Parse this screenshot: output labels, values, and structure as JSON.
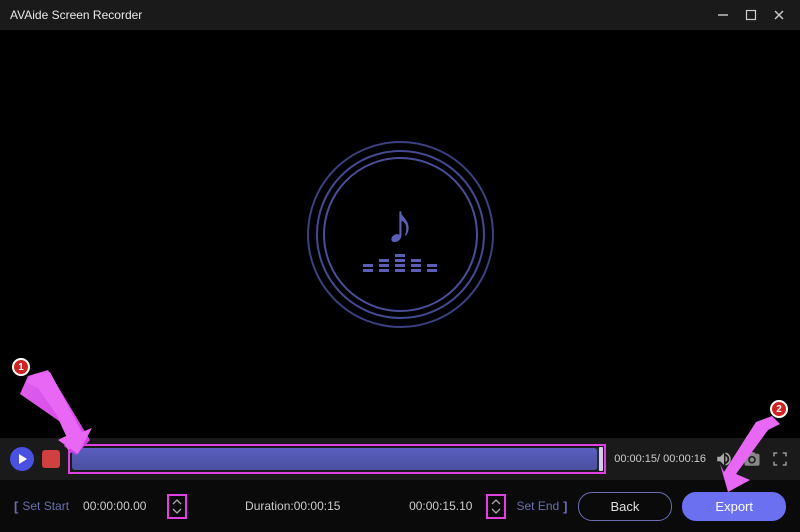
{
  "app": {
    "title": "AVAide Screen Recorder"
  },
  "player": {
    "time_current": "00:00:15",
    "time_total": "00:00:16"
  },
  "trim": {
    "set_start_label": "Set Start",
    "set_end_label": "Set End",
    "start_time": "00:00:00.00",
    "end_time": "00:00:15.10",
    "duration_label": "Duration:",
    "duration_value": "00:00:15"
  },
  "buttons": {
    "back": "Back",
    "export": "Export"
  },
  "annotations": {
    "badge1": "1",
    "badge2": "2"
  }
}
